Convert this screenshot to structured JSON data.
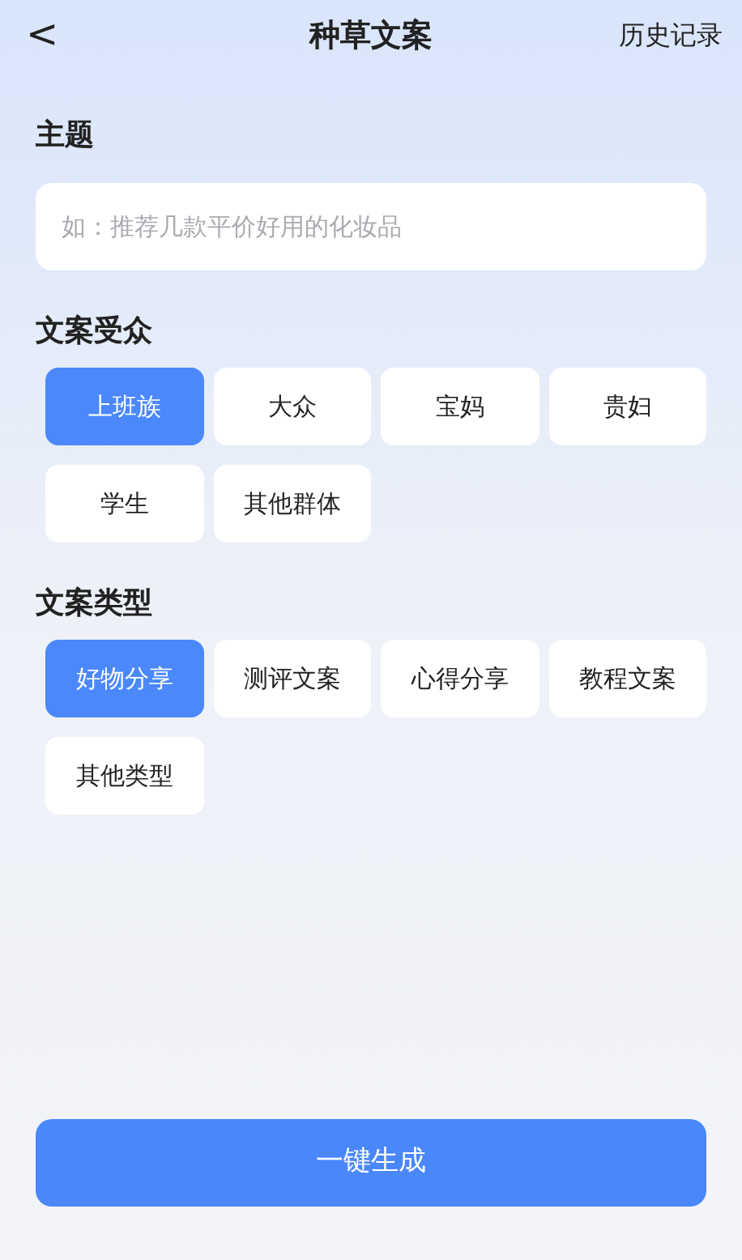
{
  "header": {
    "back": "<",
    "title": "种草文案",
    "history": "历史记录"
  },
  "topic": {
    "label": "主题",
    "placeholder": "如：推荐几款平价好用的化妆品"
  },
  "sections": [
    {
      "label": "文案受众",
      "options": [
        {
          "label": "上班族",
          "selected": true
        },
        {
          "label": "大众",
          "selected": false
        },
        {
          "label": "宝妈",
          "selected": false
        },
        {
          "label": "贵妇",
          "selected": false
        },
        {
          "label": "学生",
          "selected": false
        },
        {
          "label": "其他群体",
          "selected": false
        }
      ]
    },
    {
      "label": "文案类型",
      "options": [
        {
          "label": "好物分享",
          "selected": true
        },
        {
          "label": "测评文案",
          "selected": false
        },
        {
          "label": "心得分享",
          "selected": false
        },
        {
          "label": "教程文案",
          "selected": false
        },
        {
          "label": "其他类型",
          "selected": false
        }
      ]
    }
  ],
  "generate": "一键生成"
}
